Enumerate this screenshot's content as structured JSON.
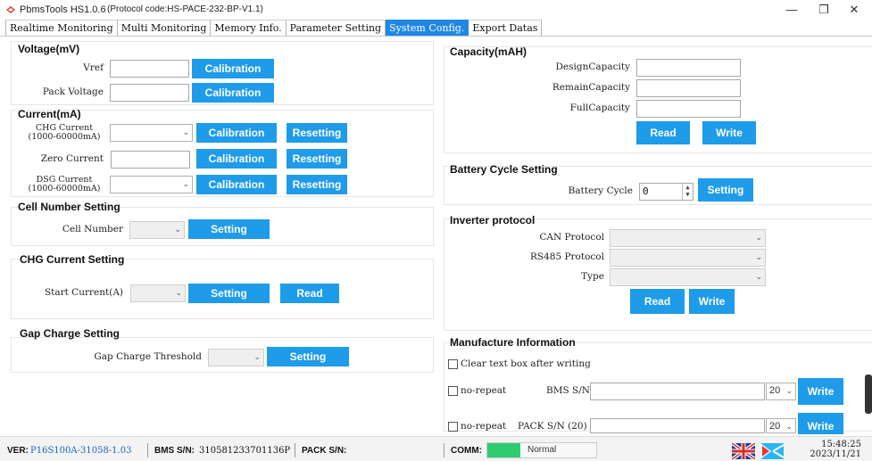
{
  "window": {
    "app_title": "PbmsTools HS1.0.6",
    "protocol_code": "(Protocol code:HS-PACE-232-BP-V1.1)",
    "min": "—",
    "max": "❐",
    "close": "✕"
  },
  "tabs": [
    {
      "label": "Realtime Monitoring",
      "active": false
    },
    {
      "label": "Multi Monitoring",
      "active": false
    },
    {
      "label": "Memory Info.",
      "active": false
    },
    {
      "label": "Parameter Setting",
      "active": false
    },
    {
      "label": "System Config.",
      "active": true
    },
    {
      "label": "Export Datas",
      "active": false
    }
  ],
  "voltage": {
    "title": "Voltage(mV)",
    "vref_label": "Vref",
    "vref_value": "",
    "pack_label": "Pack Voltage",
    "pack_value": "",
    "calibration": "Calibration"
  },
  "current": {
    "title": "Current(mA)",
    "chg_label_1": "CHG Current",
    "chg_label_2": "(1000-60000mA)",
    "zero_label": "Zero Current",
    "dsg_label_1": "DSG Current",
    "dsg_label_2": "(1000-60000mA)",
    "calibration": "Calibration",
    "resetting": "Resetting"
  },
  "cell_number": {
    "title": "Cell Number Setting",
    "label": "Cell Number",
    "setting": "Setting"
  },
  "chg_current_setting": {
    "title": "CHG Current Setting",
    "label": "Start Current(A)",
    "setting": "Setting",
    "read": "Read"
  },
  "gap_charge": {
    "title": "Gap Charge Setting",
    "label": "Gap Charge Threshold",
    "setting": "Setting"
  },
  "capacity": {
    "title": "Capacity(mAH)",
    "design_label": "DesignCapacity",
    "remain_label": "RemainCapacity",
    "full_label": "FullCapacity",
    "read": "Read",
    "write": "Write"
  },
  "battery_cycle": {
    "title": "Battery Cycle Setting",
    "label": "Battery Cycle",
    "value": "0",
    "setting": "Setting"
  },
  "inverter": {
    "title": "Inverter protocol",
    "can_label": "CAN Protocol",
    "rs485_label": "RS485 Protocol",
    "type_label": "Type",
    "read": "Read",
    "write": "Write"
  },
  "manufacture": {
    "title": "Manufacture Information",
    "clear_label": "Clear text box after writing",
    "no_repeat": "no-repeat",
    "bms_sn_label": "BMS S/N",
    "pack_sn_label": "PACK S/N (20)",
    "len_value": "20",
    "write": "Write"
  },
  "status": {
    "ver_label": "VER:",
    "ver_value": "P16S100A-31058-1.03",
    "bms_label": "BMS S/N:",
    "bms_value": "310581233701136P",
    "pack_label": "PACK S/N:",
    "pack_value": "",
    "comm_label": "COMM:",
    "comm_state": "Normal",
    "time": "15:48:25",
    "date": "2023/11/21",
    "comm_color": "#2ecc71"
  }
}
